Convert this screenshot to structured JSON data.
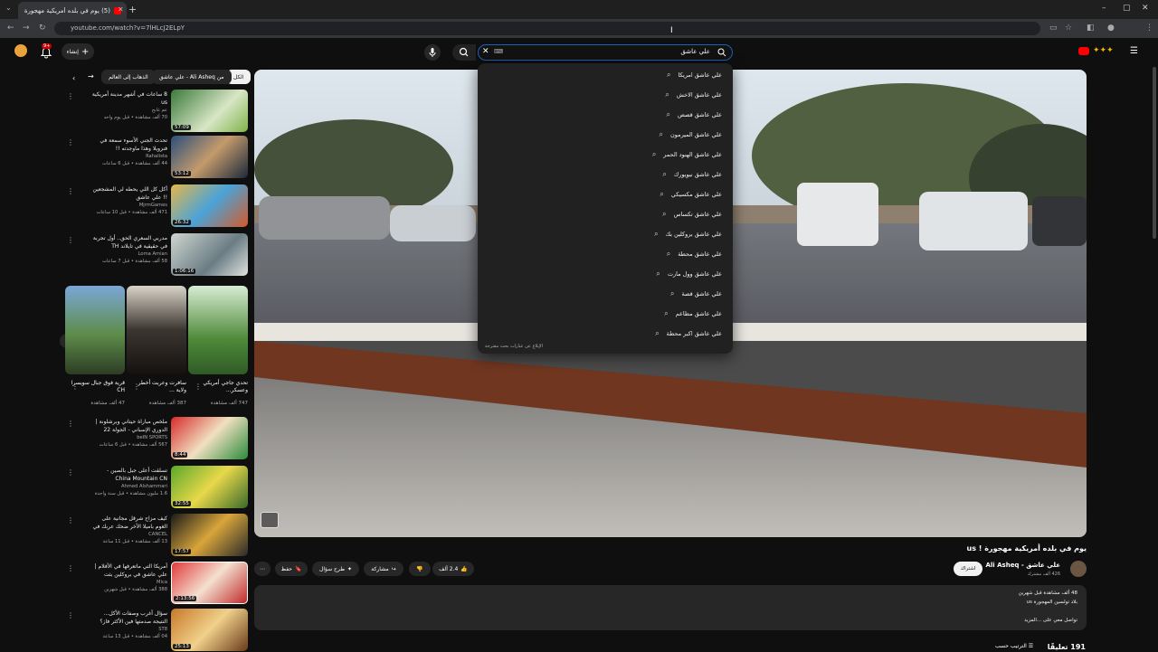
{
  "browser": {
    "tab_title": "(5) يوم في بلده أمريكية مهجورة",
    "tab_count_badge": "5",
    "url": "youtube.com/watch?v=7lHLcJ2ELpY"
  },
  "header": {
    "create_label": "إنشاء",
    "notification_count": "9+",
    "search_query": "علي عاشق"
  },
  "search_suggestions": [
    "علي عاشق امريكا",
    "علي عاشق الاخش",
    "علي عاشق قصص",
    "علي عاشق الميرمون",
    "علي عاشق الهنود الحمر",
    "علي عاشق نيويورك",
    "علي عاشق مكسيكي",
    "علي عاشق تكساس",
    "علي عاشق بروكلين بك",
    "علي عاشق محطة",
    "علي عاشق وول مارت",
    "علي عاشق قصة",
    "علي عاشق مطاعم",
    "علي عاشق اكبر محطة"
  ],
  "dropdown_footer": "الإبلاغ عن عبارات بحث مقترحة",
  "chips": [
    {
      "label": "الكل",
      "active": true
    },
    {
      "label": "من Ali Asheq - علي عاشق",
      "active": false
    },
    {
      "label": "الذهاب إلى العالم",
      "active": false
    }
  ],
  "recommendations": [
    {
      "title": "8 ساعات في أشهر مدينة أمريكية us",
      "channel": "عم غابح",
      "meta": "70 ألف مشاهدة • قبل يوم واحد",
      "duration": "57:09"
    },
    {
      "title": "تحدث الجني الأسوء سمعة في فنزويلا وهذا ماوجدته !!",
      "channel": "Rahalista",
      "meta": "44 ألف مشاهدة • قبل 6 ساعات",
      "duration": "53:12"
    },
    {
      "title": "أكل كل اللي يحطه لي المشجعين !! علي عاشق",
      "channel": "MjrmGames",
      "meta": "471 ألف مشاهدة • قبل 10 ساعات",
      "duration": "26:32"
    },
    {
      "title": "مدربي السعري الحق.. أول تجربة في حقيقية في تايلاند TH",
      "channel": "Loma Amian",
      "meta": "58 ألف مشاهدة • قبل 7 ساعات",
      "duration": "1:06:16"
    }
  ],
  "shorts": [
    {
      "title": "تحدي جاجي أمريكي وعسكر...",
      "views": "747 ألف مشاهدة"
    },
    {
      "title": "سافرت وعربت أخطر ولاية ...",
      "views": "387 ألف مشاهدة"
    },
    {
      "title": "قرية فوق جبال سويسرا CH",
      "views": "47 ألف مشاهدة"
    }
  ],
  "recommendations2": [
    {
      "title": "ملخص مباراة حيتاني وبرشلونة | الدوري الإسباني - الجولة 22",
      "channel": "beIN SPORTS",
      "meta": "567 ألف مشاهدة • قبل 6 ساعات",
      "duration": "8:44"
    },
    {
      "title": "تسلقت أعلى جبل بالصين - China Mountain CN",
      "channel": "Ahmed Alshammari",
      "meta": "1.6 مليون مشاهدة • قبل سنة واحدة",
      "duration": "32:55"
    },
    {
      "title": "كيف مزاح شرقل مجانية على الغوم باميلا الأخر ضحك عربك في بلايستيشن 5",
      "channel": "CANCEL",
      "meta": "13 ألف مشاهدة • قبل 11 ساعة",
      "duration": "17:57"
    },
    {
      "title": "أمريكا التي ماتعرفها في الأفلام | علي عاشق في بروكلين بثت سنتيان",
      "channel": "Mica",
      "meta": "388 ألف مشاهدة • قبل شهرين",
      "duration": "2:13:56"
    },
    {
      "title": "سؤال أغرب وصفات الأكل... النتيجة صدمتها فين الأكثر فاز؟",
      "channel": "ST8",
      "meta": "04 ألف مشاهدة • قبل 13 ساعة",
      "duration": "25:13"
    }
  ],
  "video": {
    "title": "يوم في بلده أمريكية مهجورة ! us",
    "channel": "علي عاشق - Ali Asheq",
    "subscribers": "426 ألف مشترك",
    "subscribe_label": "اشتراك",
    "likes": "2.4 ألف",
    "share_label": "مشاركة",
    "ask_label": "طرح سؤال",
    "save_label": "حفظ",
    "desc_meta": "48 ألف مشاهدة  قبل شهرين",
    "desc_line1": "بلاد تولسين المهجورة us",
    "desc_line2": "تواصل معي على   ...المزيد",
    "comments_count": "191 تعليقًا",
    "sort_label": "الترتيب حسب"
  },
  "colors": {
    "accent_red": "#ff0000",
    "bg": "#0f0f0f",
    "chip_bg": "#272727",
    "focus_blue": "#1c62b9"
  }
}
